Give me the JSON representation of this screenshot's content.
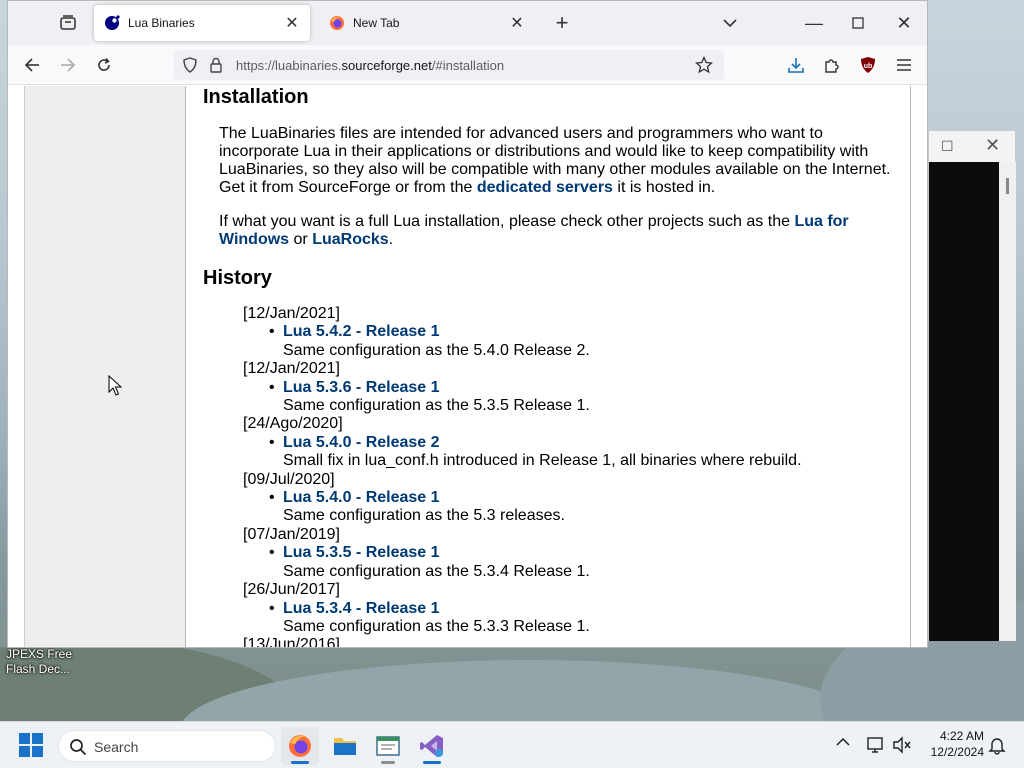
{
  "browser": {
    "tabs": [
      {
        "title": "Lua Binaries",
        "active": true
      },
      {
        "title": "New Tab",
        "active": false
      }
    ],
    "url_prefix": "https://luabinaries.",
    "url_domain": "sourceforge.net",
    "url_suffix": "/#installation"
  },
  "page": {
    "installation_heading": "Installation",
    "p1_before_link": "The LuaBinaries files are intended for advanced users and programmers who want to incorporate Lua in their applications or distributions and would like to keep compatibility with LuaBinaries, so they also will be compatible with many other modules available on the Internet. Get it from SourceForge or from the ",
    "p1_link": "dedicated servers",
    "p1_after_link": " it is hosted in.",
    "p2_before": "If what you want is a full Lua installation, please check other projects such as the ",
    "p2_link1": "Lua for Windows",
    "p2_mid": " or ",
    "p2_link2": "LuaRocks",
    "p2_after": ".",
    "history_heading": "History",
    "history": [
      {
        "date": "[12/Jan/2021]",
        "release": "Lua 5.4.2 - Release 1",
        "desc": "Same configuration as the 5.4.0 Release 2."
      },
      {
        "date": "[12/Jan/2021]",
        "release": "Lua 5.3.6 - Release 1",
        "desc": "Same configuration as the 5.3.5 Release 1."
      },
      {
        "date": "[24/Ago/2020]",
        "release": "Lua 5.4.0 - Release 2",
        "desc": "Small fix in lua_conf.h introduced in Release 1, all binaries where rebuild."
      },
      {
        "date": "[09/Jul/2020]",
        "release": "Lua 5.4.0 - Release 1",
        "desc": "Same configuration as the 5.3 releases."
      },
      {
        "date": "[07/Jan/2019]",
        "release": "Lua 5.3.5 - Release 1",
        "desc": "Same configuration as the 5.3.4 Release 1."
      },
      {
        "date": "[26/Jun/2017]",
        "release": "Lua 5.3.4 - Release 1",
        "desc": "Same configuration as the 5.3.3 Release 1."
      },
      {
        "date": "[13/Jun/2016]",
        "release": "",
        "desc": ""
      }
    ]
  },
  "desktop": {
    "icon_label": "JPEXS Free Flash Dec..."
  },
  "taskbar": {
    "search_label": "Search",
    "time": "4:22 AM",
    "date": "12/2/2024"
  },
  "colors": {
    "link": "#003a74",
    "accent": "#1a73c8"
  }
}
